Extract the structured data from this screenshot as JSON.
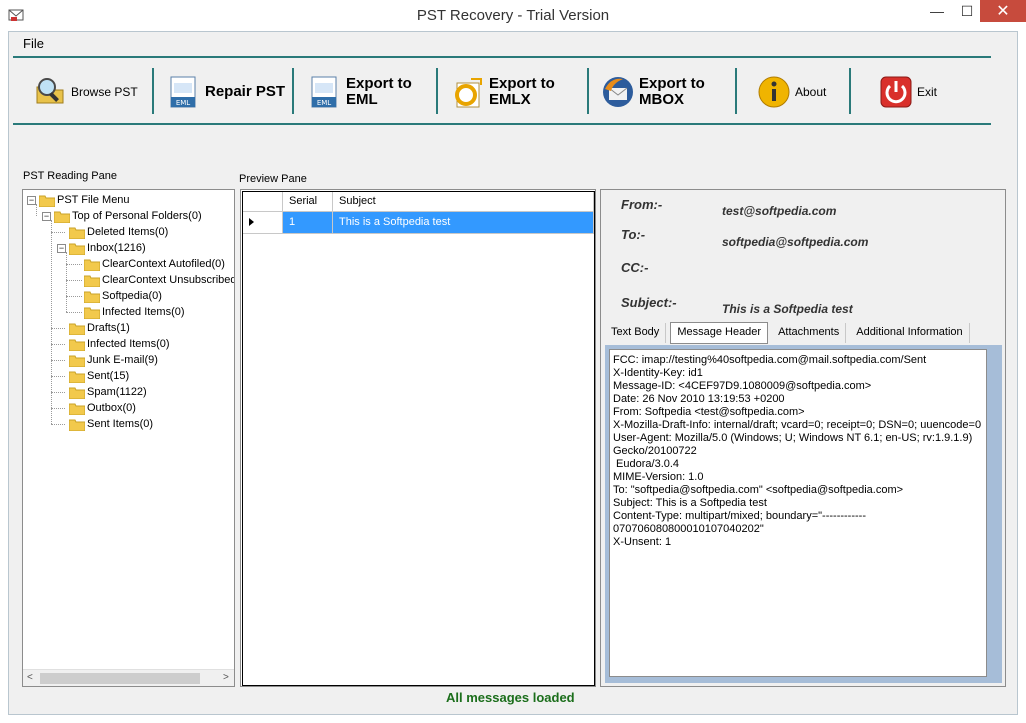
{
  "window": {
    "title": "PST Recovery - Trial Version",
    "min_glyph": "—",
    "max_glyph": "☐",
    "close_glyph": "✕"
  },
  "menu": {
    "file": "File"
  },
  "toolbar": {
    "browse": "Browse PST",
    "repair": "Repair PST",
    "export_eml_1": "Export to",
    "export_eml_2": "EML",
    "export_emlx_1": "Export to",
    "export_emlx_2": "EMLX",
    "export_mbox_1": "Export to",
    "export_mbox_2": "MBOX",
    "about": "About",
    "exit": "Exit"
  },
  "panes": {
    "reading": "PST Reading Pane",
    "preview": "Preview Pane"
  },
  "tree": {
    "root": "PST File Menu",
    "top": "Top of Personal Folders(0)",
    "deleted": "Deleted Items(0)",
    "inbox": "Inbox(1216)",
    "cc_autofiled": "ClearContext Autofiled(0)",
    "cc_unsub": "ClearContext Unsubscribed",
    "softpedia": "Softpedia(0)",
    "inbox_infected": "Infected Items(0)",
    "drafts": "Drafts(1)",
    "infected": "Infected Items(0)",
    "junk": "Junk E-mail(9)",
    "sent": "Sent(15)",
    "spam": "Spam(1122)",
    "outbox": "Outbox(0)",
    "sent_items": "Sent Items(0)",
    "scroll_left": "<",
    "scroll_right": ">"
  },
  "grid": {
    "col_serial": "Serial",
    "col_subject": "Subject",
    "row_serial": "1",
    "row_subject": "This is a Softpedia test"
  },
  "header": {
    "from_label": "From:-",
    "to_label": "To:-",
    "cc_label": "CC:-",
    "subject_label": "Subject:-",
    "from_value": "test@softpedia.com",
    "to_value": "softpedia@softpedia.com",
    "subject_value": "This is a Softpedia test"
  },
  "tabs": {
    "text_body": "Text Body",
    "message_header": "Message Header",
    "attachments": "Attachments",
    "additional": "Additional Information"
  },
  "message_header_text": "FCC: imap://testing%40softpedia.com@mail.softpedia.com/Sent\nX-Identity-Key: id1\nMessage-ID: <4CEF97D9.1080009@softpedia.com>\nDate: 26 Nov 2010 13:19:53 +0200\nFrom: Softpedia <test@softpedia.com>\nX-Mozilla-Draft-Info: internal/draft; vcard=0; receipt=0; DSN=0; uuencode=0\nUser-Agent: Mozilla/5.0 (Windows; U; Windows NT 6.1; en-US; rv:1.9.1.9)\nGecko/20100722\n Eudora/3.0.4\nMIME-Version: 1.0\nTo: \"softpedia@softpedia.com\" <softpedia@softpedia.com>\nSubject: This is a Softpedia test\nContent-Type: multipart/mixed; boundary=\"------------\n070706080800010107040202\"\nX-Unsent: 1",
  "status": "All messages loaded",
  "colors": {
    "accent": "#2a7a7a",
    "selection": "#3399ff",
    "close": "#c74b3d",
    "status": "#1b6e1b"
  },
  "icons": {
    "browse": "magnifier-folder-icon",
    "repair": "eml-file-icon",
    "eml": "eml-file-icon",
    "emlx": "emlx-icon",
    "mbox": "thunderbird-icon",
    "about": "info-icon",
    "exit": "power-icon"
  }
}
